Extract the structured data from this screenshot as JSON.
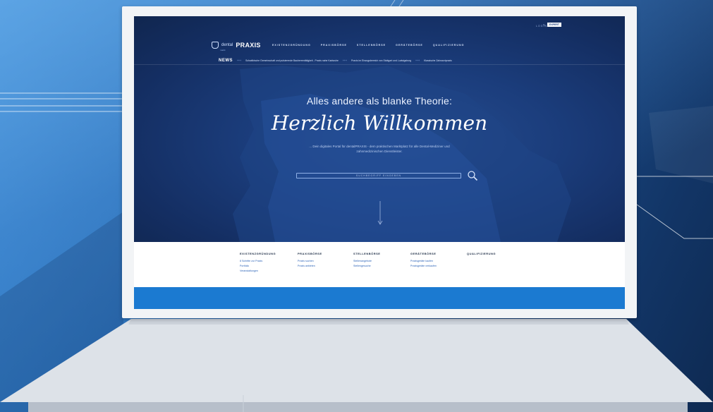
{
  "colors": {
    "hero_bg": "#1b3d7c",
    "accent_band": "#1b7ad1",
    "link": "#2d64b8",
    "frame": "#f2f4f6"
  },
  "site": {
    "topbar": {
      "login_label": "LOGIN",
      "by_label": "by",
      "expert_badge": "EXPERT"
    },
    "logo": {
      "dental": "dental",
      "praxis": "PRAXIS",
      "sub": "markt"
    },
    "nav": [
      "EXISTENZGRÜNDUNG",
      "PRAXISBÖRSE",
      "STELLENBÖRSE",
      "GERÄTEBÖRSE",
      "QUALIFIZIERUNG"
    ],
    "news": {
      "label": "NEWS",
      "separator": "+++",
      "items": [
        "Schwäbische Gemeinschaft und pulsierende Bauherrentätigkeit - Praxis nahe Karlsruhe",
        "Praxis im Einzugsbereich von Stuttgart und Ludwigsburg",
        "Klassische Zahnarztpraxis"
      ]
    },
    "hero": {
      "tagline": "Alles andere als blanke Theorie:",
      "welcome": "Herzlich Willkommen",
      "description": "... Dein digitales Portal für dentalPRAXIS - dem praktischen Marktplatz für alle Dental-Mediziner und zahnmedizinischen Dienstleister.",
      "search_placeholder": "SUCHBEGRIFF EINGEBEN"
    },
    "footer_columns": [
      {
        "heading": "EXISTENZGRÜNDUNG",
        "links": [
          "8 Schritte zur Praxis",
          "Portfolio",
          "Veranstaltungen"
        ]
      },
      {
        "heading": "PRAXISBÖRSE",
        "links": [
          "Praxis suchen",
          "Praxis anbieten"
        ]
      },
      {
        "heading": "STELLENBÖRSE",
        "links": [
          "Stellenangebote",
          "Stellengesuche"
        ]
      },
      {
        "heading": "GERÄTEBÖRSE",
        "links": [
          "Praxisgeräte kaufen",
          "Praxisgeräte verkaufen"
        ]
      },
      {
        "heading": "QUALIFIZIERUNG",
        "links": []
      }
    ],
    "icons": {
      "search": "search-icon",
      "arrow_down": "arrow-down-icon",
      "logo": "tooth-icon"
    }
  }
}
